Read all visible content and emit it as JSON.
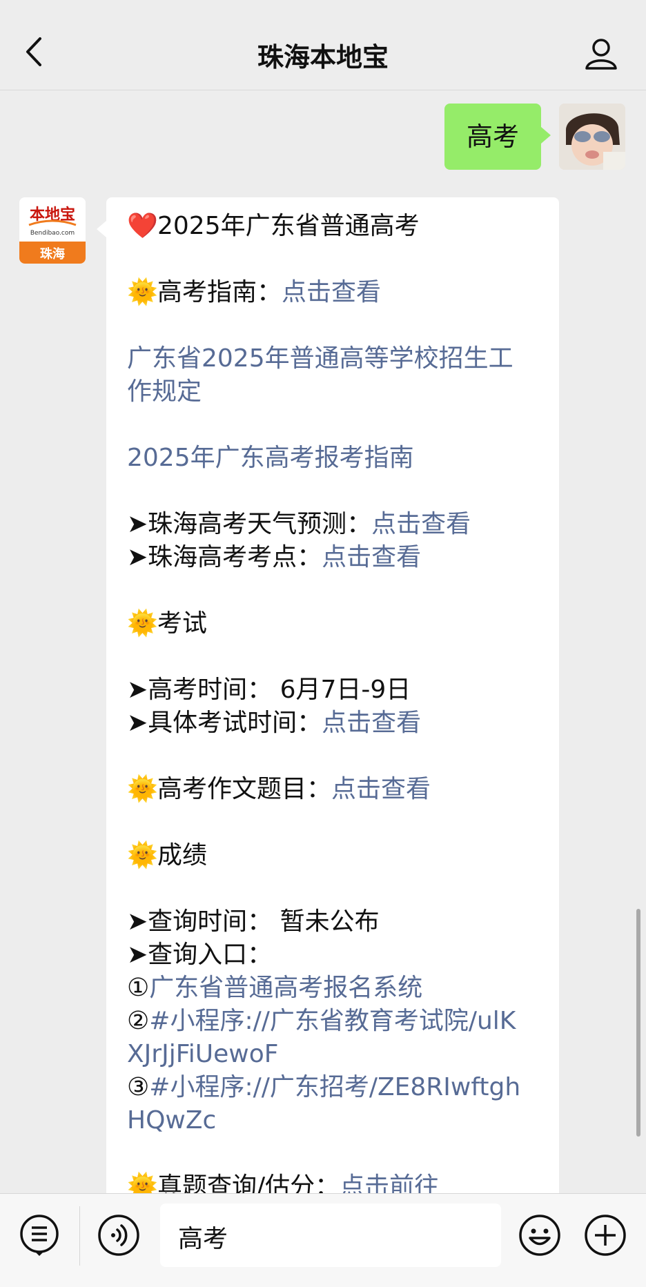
{
  "header": {
    "title": "珠海本地宝"
  },
  "outgoing_message": "高考",
  "bot_avatar": {
    "logo_text": "本地宝",
    "logo_sub": "Bendibao.com",
    "city": "珠海"
  },
  "message_lines": [
    [
      {
        "t": "❤️",
        "k": "emoji"
      },
      {
        "t": "2025年广东省普通高考"
      }
    ],
    [],
    [
      {
        "t": "🌞",
        "k": "emoji"
      },
      {
        "t": "高考指南："
      },
      {
        "t": "点击查看",
        "k": "link"
      }
    ],
    [],
    [
      {
        "t": "广东省2025年普通高等学校招生工",
        "k": "link"
      }
    ],
    [
      {
        "t": "作规定",
        "k": "link"
      }
    ],
    [],
    [
      {
        "t": "2025年广东高考报考指南",
        "k": "link"
      }
    ],
    [],
    [
      {
        "t": "➤珠海高考天气预测："
      },
      {
        "t": "点击查看",
        "k": "link"
      }
    ],
    [
      {
        "t": "➤珠海高考考点："
      },
      {
        "t": "点击查看",
        "k": "link"
      }
    ],
    [],
    [
      {
        "t": "🌞",
        "k": "emoji"
      },
      {
        "t": "考试"
      }
    ],
    [],
    [
      {
        "t": "➤高考时间： 6月7日-9日"
      }
    ],
    [
      {
        "t": "➤具体考试时间："
      },
      {
        "t": "点击查看",
        "k": "link"
      }
    ],
    [],
    [
      {
        "t": "🌞",
        "k": "emoji"
      },
      {
        "t": "高考作文题目："
      },
      {
        "t": "点击查看",
        "k": "link"
      }
    ],
    [],
    [
      {
        "t": "🌞",
        "k": "emoji"
      },
      {
        "t": "成绩"
      }
    ],
    [],
    [
      {
        "t": "➤查询时间： 暂未公布"
      }
    ],
    [
      {
        "t": "➤查询入口："
      }
    ],
    [
      {
        "t": "①"
      },
      {
        "t": "广东省普通高考报名系统",
        "k": "link"
      }
    ],
    [
      {
        "t": "②"
      },
      {
        "t": "#小程序://广东省教育考试院/ulK",
        "k": "link"
      }
    ],
    [
      {
        "t": "XJrJjFiUewoF",
        "k": "link"
      }
    ],
    [
      {
        "t": "③"
      },
      {
        "t": "#小程序://广东招考/ZE8RIwftgh",
        "k": "link"
      }
    ],
    [
      {
        "t": "HQwZc",
        "k": "link"
      }
    ],
    [],
    [
      {
        "t": "🌞",
        "k": "emoji"
      },
      {
        "t": "真题查询/估分："
      },
      {
        "t": "点击前往",
        "k": "link"
      }
    ]
  ],
  "input_bar": {
    "value": "高考"
  },
  "icons": [
    "back-arrow-icon",
    "person-icon",
    "menu-list-icon",
    "voice-icon",
    "emoji-icon",
    "plus-icon"
  ],
  "colors": {
    "accent_green": "#95ec69",
    "link": "#576b95",
    "background": "#ededed"
  }
}
